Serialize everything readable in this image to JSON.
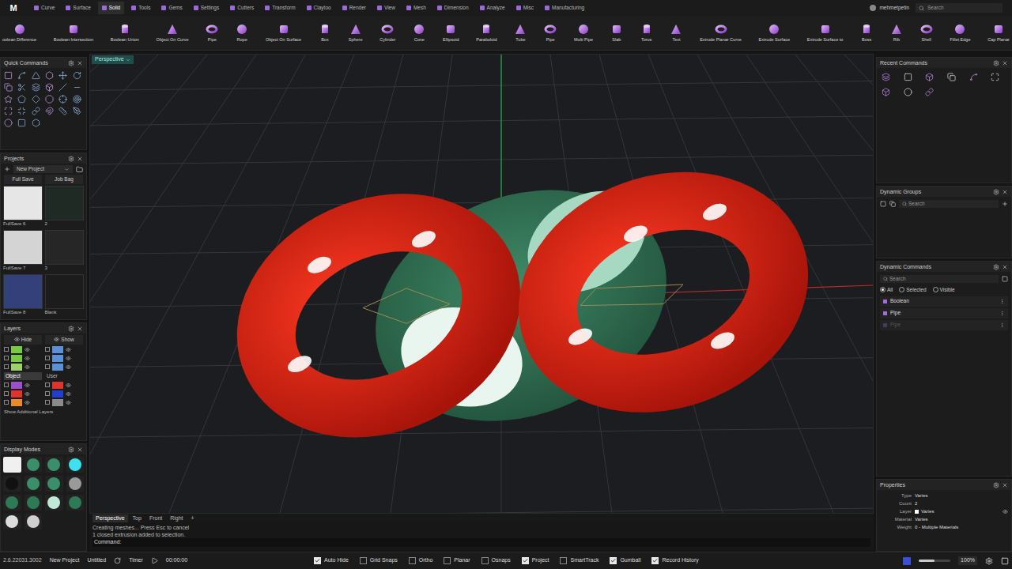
{
  "top_bar": {
    "logo": "M",
    "user": "mehmetpetin",
    "search_placeholder": "Search",
    "tabs": [
      {
        "label": "Curve",
        "selected": false
      },
      {
        "label": "Surface",
        "selected": false
      },
      {
        "label": "Solid",
        "selected": true
      },
      {
        "label": "Tools",
        "selected": false
      },
      {
        "label": "Gems",
        "selected": false
      },
      {
        "label": "Settings",
        "selected": false
      },
      {
        "label": "Cutters",
        "selected": false
      },
      {
        "label": "Transform",
        "selected": false
      },
      {
        "label": "Claytoo",
        "selected": false
      },
      {
        "label": "Render",
        "selected": false
      },
      {
        "label": "View",
        "selected": false
      },
      {
        "label": "Mesh",
        "selected": false
      },
      {
        "label": "Dimension",
        "selected": false
      },
      {
        "label": "Analyze",
        "selected": false
      },
      {
        "label": "Misc",
        "selected": false
      },
      {
        "label": "Manufacturing",
        "selected": false
      }
    ]
  },
  "toolbar": [
    "oolean Difference",
    "Boolean Intersection",
    "Boolean Union",
    "Object On Curve",
    "Pipe",
    "Rope",
    "Object On Surface",
    "Box",
    "Sphere",
    "Cylinder",
    "Cone",
    "Ellipsoid",
    "Paraboloid",
    "Tube",
    "Pipe",
    "Multi Pipe",
    "Slab",
    "Torus",
    "Text",
    "Extrude Planar Curve",
    "Extrude Surface",
    "Extrude Surface to",
    "Boss",
    "Rib",
    "Shell",
    "Fillet Edge",
    "Cap Planar"
  ],
  "quick_commands": {
    "title": "Quick Commands"
  },
  "projects": {
    "title": "Projects",
    "project": "New Project",
    "buttons": [
      "Full Save",
      "Job Bag"
    ],
    "thumbnails": [
      {
        "label": "FullSave 6",
        "color": "#e6e6e6"
      },
      {
        "label": "2",
        "color": "#1f2a24"
      },
      {
        "label": "FullSave 7",
        "color": "#d4d4d4"
      },
      {
        "label": "3",
        "color": "#262626"
      },
      {
        "label": "FullSave 8",
        "color": "#34407a"
      },
      {
        "label": "Blank",
        "color": "#1c1c1c"
      }
    ]
  },
  "layers": {
    "title": "Layers",
    "buttons": [
      "Hide",
      "Show"
    ],
    "footer": "Show Additional Layers",
    "rows": [
      {
        "kind": "swatch",
        "cells": [
          {
            "color": "#7ac943",
            "visible": true
          },
          {
            "color": "#5b8fd6",
            "visible": true
          }
        ]
      },
      {
        "kind": "swatch",
        "cells": [
          {
            "color": "#7ac943",
            "visible": true
          },
          {
            "color": "#5b8fd6",
            "visible": true
          }
        ]
      },
      {
        "kind": "swatch",
        "cells": [
          {
            "color": "#9bd26b",
            "visible": true
          },
          {
            "color": "#5b8fd6",
            "visible": true
          }
        ]
      },
      {
        "kind": "named",
        "cells": [
          {
            "label": "Object",
            "selected": true
          },
          {
            "label": "User",
            "selected": false
          }
        ]
      },
      {
        "kind": "swatch",
        "cells": [
          {
            "color": "#9b4fc9",
            "visible": true
          },
          {
            "color": "#e0332a",
            "visible": true
          }
        ]
      },
      {
        "kind": "swatch",
        "cells": [
          {
            "color": "#e0332a",
            "visible": true
          },
          {
            "color": "#1f3fd0",
            "visible": true
          }
        ]
      },
      {
        "kind": "swatch",
        "cells": [
          {
            "color": "#e8892a",
            "visible": true
          },
          {
            "color": "#8a8a8a",
            "visible": true
          }
        ]
      }
    ]
  },
  "display_modes": {
    "title": "Display Modes",
    "modes": [
      {
        "color": "#eeeeee",
        "selected": true
      },
      {
        "color": "#3a8f6a",
        "selected": false
      },
      {
        "color": "#3a8f6a",
        "selected": false
      },
      {
        "color": "#3fe0f0",
        "selected": false
      },
      {
        "color": "#111111",
        "selected": false
      },
      {
        "color": "#3a8f6a",
        "selected": false
      },
      {
        "color": "#3a8f6a",
        "selected": false
      },
      {
        "color": "#9a9a9a",
        "selected": false
      },
      {
        "color": "#2f7a56",
        "selected": false
      },
      {
        "color": "#2f7a56",
        "selected": false
      },
      {
        "color": "#bfe8d6",
        "selected": false
      },
      {
        "color": "#2f7a56",
        "selected": false
      },
      {
        "color": "#dddddd",
        "selected": false
      },
      {
        "color": "#cfcfcf",
        "selected": false
      }
    ]
  },
  "viewport": {
    "label": "Perspective",
    "tabs": [
      {
        "label": "Perspective",
        "selected": true
      },
      {
        "label": "Top",
        "selected": false
      },
      {
        "label": "Front",
        "selected": false
      },
      {
        "label": "Right",
        "selected": false
      },
      {
        "label": "+",
        "selected": false
      }
    ]
  },
  "command_line": {
    "lines": [
      "Creating meshes... Press Esc to cancel",
      "1 closed extrusion added to selection."
    ],
    "prompt": "Command:"
  },
  "recent_commands": {
    "title": "Recent Commands"
  },
  "dynamic_groups": {
    "title": "Dynamic Groups",
    "search_placeholder": "Search"
  },
  "dynamic_commands": {
    "title": "Dynamic Commands",
    "search_placeholder": "Search",
    "filters": [
      {
        "label": "All",
        "selected": true
      },
      {
        "label": "Selected",
        "selected": false
      },
      {
        "label": "Visible",
        "selected": false
      }
    ],
    "items": [
      {
        "label": "Boolean",
        "disabled": false
      },
      {
        "label": "Pipe",
        "disabled": false
      },
      {
        "label": "Pipe",
        "disabled": true
      }
    ]
  },
  "properties": {
    "title": "Properties",
    "rows": [
      {
        "key": "Type",
        "value": "Varies",
        "kind": "text"
      },
      {
        "key": "Count",
        "value": "2",
        "kind": "text"
      },
      {
        "key": "Layer",
        "value": "Varies",
        "kind": "layer"
      },
      {
        "key": "Material",
        "value": "Varies",
        "kind": "text"
      },
      {
        "key": "Weight",
        "value": "0 - Multiple Materials",
        "kind": "text"
      }
    ]
  },
  "status_bar": {
    "version": "2.6.22031.3002",
    "project": "New Project",
    "file": "Untitled",
    "timer_label": "Timer",
    "time": "00:00:00",
    "zoom": "100%",
    "zoom_level": 0.5,
    "toggles": [
      {
        "label": "Auto Hide",
        "checked": true
      },
      {
        "label": "Grid Snaps",
        "checked": false
      },
      {
        "label": "Ortho",
        "checked": false
      },
      {
        "label": "Planar",
        "checked": false
      },
      {
        "label": "Osnaps",
        "checked": false
      },
      {
        "label": "Project",
        "checked": true
      },
      {
        "label": "SmartTrack",
        "checked": false
      },
      {
        "label": "Gumball",
        "checked": true
      },
      {
        "label": "Record History",
        "checked": true
      }
    ]
  }
}
